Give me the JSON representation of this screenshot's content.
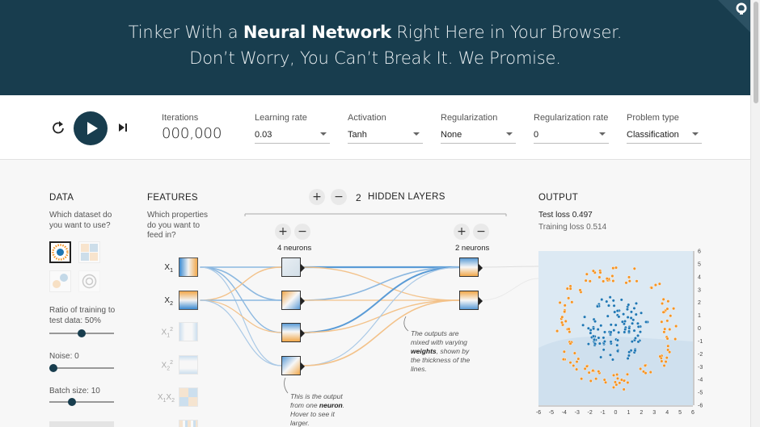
{
  "header": {
    "line1_pre": "Tinker With a ",
    "line1_bold": "Neural Network",
    "line1_post": " Right Here in Your Browser.",
    "line2": "Don’t Worry, You Can’t Break It. We Promise.",
    "github_icon": "github-icon"
  },
  "controls": {
    "iterations_label": "Iterations",
    "iterations_value": "000,000",
    "learning_rate_label": "Learning rate",
    "learning_rate_value": "0.03",
    "activation_label": "Activation",
    "activation_value": "Tanh",
    "regularization_label": "Regularization",
    "regularization_value": "None",
    "regularization_rate_label": "Regularization rate",
    "regularization_rate_value": "0",
    "problem_type_label": "Problem type",
    "problem_type_value": "Classification"
  },
  "data_panel": {
    "title": "DATA",
    "question": "Which dataset do you want to use?",
    "ratio_label": "Ratio of training to test data:",
    "ratio_value": "50%",
    "ratio_fraction": 0.5,
    "noise_label": "Noise:",
    "noise_value": "0",
    "noise_fraction": 0.0,
    "batch_label": "Batch size:",
    "batch_value": "10",
    "batch_fraction": 0.33
  },
  "features_panel": {
    "title": "FEATURES",
    "question": "Which properties do you want to feed in?",
    "features": [
      {
        "base": "X",
        "sub": "1",
        "sup": "",
        "active": true
      },
      {
        "base": "X",
        "sub": "2",
        "sup": "",
        "active": true
      },
      {
        "base": "X",
        "sub": "1",
        "sup": "2",
        "active": false
      },
      {
        "base": "X",
        "sub": "2",
        "sup": "2",
        "active": false
      },
      {
        "base": "X",
        "sub": "1",
        "base2": "X",
        "sub2": "2",
        "active": false
      }
    ]
  },
  "network": {
    "hidden_layers_count": "2",
    "hidden_layers_label": "HIDDEN LAYERS",
    "layer1_neurons": "4 neurons",
    "layer2_neurons": "2 neurons",
    "annotation_neuron_pre": "This is the output from one ",
    "annotation_neuron_bold": "neuron",
    "annotation_neuron_post": ". Hover to see it larger.",
    "annotation_weights_pre": "The outputs are mixed with varying ",
    "annotation_weights_bold": "weights",
    "annotation_weights_post": ", shown by the thickness of the lines."
  },
  "output_panel": {
    "title": "OUTPUT",
    "test_loss_label": "Test loss",
    "test_loss_value": "0.497",
    "training_loss_label": "Training loss",
    "training_loss_value": "0.514",
    "x_ticks": [
      "-6",
      "-5",
      "-4",
      "-3",
      "-2",
      "-1",
      "0",
      "1",
      "2",
      "3",
      "4",
      "5",
      "6"
    ],
    "y_ticks": [
      "6",
      "5",
      "4",
      "3",
      "2",
      "1",
      "0",
      "-1",
      "-2",
      "-3",
      "-4",
      "-5",
      "-6"
    ]
  },
  "colors": {
    "header_bg": "#183d4e",
    "blue": "#1f77b4",
    "orange": "#f59322"
  }
}
